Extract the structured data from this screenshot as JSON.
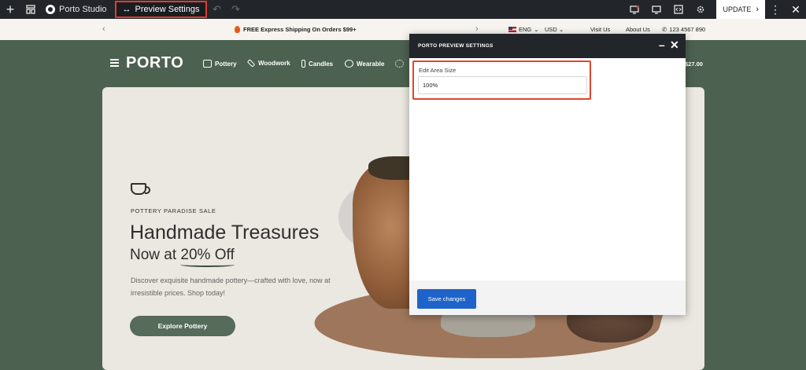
{
  "toolbar": {
    "studio_label": "Porto Studio",
    "preview_label": "Preview Settings",
    "update_label": "UPDATE"
  },
  "promo": {
    "shipping_text": "FREE Express Shipping On Orders $99+",
    "language": "ENG",
    "currency": "USD",
    "visit_us": "Visit Us",
    "about_us": "About Us",
    "phone": "123 4567 890"
  },
  "header": {
    "logo": "PORTO",
    "nav": [
      "Pottery",
      "Woodwork",
      "Candles",
      "Wearable"
    ],
    "cart_total": "$27.00"
  },
  "hero": {
    "eyebrow": "POTTERY PARADISE SALE",
    "title": "Handmade Treasures",
    "subtitle_prefix": "Now at ",
    "subtitle_highlight": "20% Off",
    "description": "Discover exquisite handmade pottery—crafted with love, now at irresistible prices. Shop today!",
    "cta_label": "Explore Pottery"
  },
  "modal": {
    "title": "PORTO PREVIEW SETTINGS",
    "field_label": "Edit Area Size",
    "field_value": "100%",
    "save_label": "Save changes"
  },
  "colors": {
    "toolbar_bg": "#222529",
    "accent_blue": "#1e63c9",
    "highlight_red": "#e03c31",
    "site_green": "#4d6150",
    "button_green": "#566b59"
  }
}
